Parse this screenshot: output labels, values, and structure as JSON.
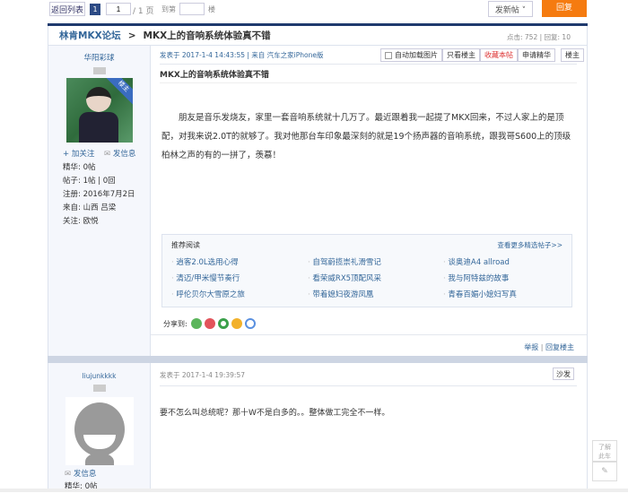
{
  "toolbar": {
    "back": "返回列表",
    "page_current": "1",
    "page_input": "1",
    "page_total": "/ 1 页",
    "goto": "到第",
    "goto_suffix": "楼",
    "new_post": "发新帖 ˅",
    "reply": "回复"
  },
  "title": {
    "forum": "林肯MKX论坛",
    "sep": ">",
    "thread": "MKX上的音响系统体验真不错",
    "stats": "点击: 752 | 回复: 10"
  },
  "post1": {
    "author": "华阳彩球",
    "badge": "楼主",
    "follow": "加关注",
    "message": "发信息",
    "stats": [
      "精华: 0帖",
      "帖子: 1帖 | 0回",
      "注册: 2016年7月2日",
      "来自: 山西 吕梁",
      "关注: 欧悦"
    ],
    "meta": "发表于 2017-1-4 14:43:55 | 来自 汽车之家iPhone版",
    "actions": {
      "autoload": "自动加载图片",
      "only_op": "只看楼主",
      "fav": "收藏本帖",
      "apply": "申请精华",
      "floor": "楼主"
    },
    "title": "MKX上的音响系统体验真不错",
    "body": "朋友是音乐发烧友，家里一套音响系统就十几万了。最近跟着我一起提了MKX回来，不过人家上的是顶配，对我来说2.0T的就够了。我对他那台车印象最深刻的就是19个扬声器的音响系统，跟我哥S600上的顶级柏林之声的有的一拼了，羡慕！",
    "recommend": {
      "title": "推荐阅读",
      "more": "查看更多精选帖子>>",
      "items": [
        "逍客2.0L选用心得",
        "自驾蔚揽崇礼滑雪记",
        "谈奥迪A4 allroad",
        "清迈/甲米慢节奏行",
        "看荣威RX5顶配风采",
        "我与阿特兹的故事",
        "呼伦贝尔大雪原之旅",
        "带着媳妇夜游凤凰",
        "青春百媚小媳妇写真"
      ]
    },
    "share": "分享到:",
    "report": "举报",
    "reply_op": "回复楼主"
  },
  "post2": {
    "author": "liujunkkkk",
    "message": "发信息",
    "stats": [
      "精华: 0帖"
    ],
    "meta": "发表于 2017-1-4 19:39:57",
    "floor": "沙发",
    "body": "要不怎么叫总统呢？那十W不是白多的。。整体做工完全不一样。"
  },
  "float": {
    "about": "了解此车"
  },
  "colors": {
    "navy": "#1f3a6e",
    "orange": "#f57b10",
    "link": "#336699",
    "red": "#d33"
  }
}
